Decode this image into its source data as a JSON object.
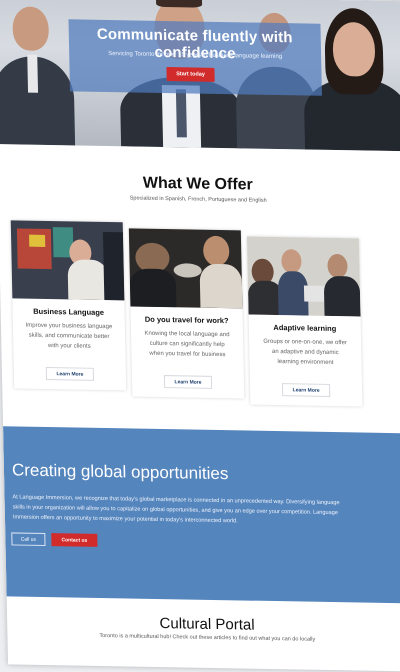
{
  "hero": {
    "title": "Communicate fluently with confidence",
    "subtitle": "Servicing Toronto for over 15 years in business language learning",
    "cta_label": "Start today"
  },
  "offer": {
    "title": "What We Offer",
    "subtitle": "Specialized in Spanish, French, Portuguese and English",
    "cards": [
      {
        "title": "Business Language",
        "description": "Improve your business language skills, and communicate better with your clients",
        "button_label": "Learn More"
      },
      {
        "title": "Do you travel for work?",
        "description": "Knowing the local language and culture can significantly help when you travel for business",
        "button_label": "Learn More"
      },
      {
        "title": "Adaptive learning",
        "description": "Groups or one-on-one, we offer an adaptive and dynamic learning environment",
        "button_label": "Learn More"
      }
    ]
  },
  "global": {
    "title": "Creating global opportunities",
    "text": "At Language Immersion, we recognize that today's global marketplace is connected in an unprecedented way. Diversifying language skills in your organization will allow you to capitalize on global opportunities, and give you an edge over your competition. Language Immersion offers an opportunity to maximize your potential in today's interconnected world.",
    "call_label": "Call us",
    "contact_label": "Contact us"
  },
  "portal": {
    "title": "Cultural Portal",
    "subtitle": "Toronto is a multicultural hub! Check out these articles to find out what you can do locally"
  },
  "colors": {
    "brand_blue": "#5585bd",
    "cta_red": "#d12b2b"
  }
}
